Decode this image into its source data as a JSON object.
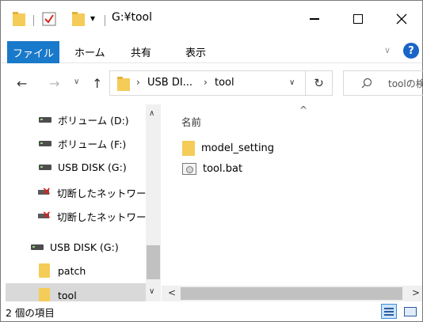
{
  "titlebar": {
    "title": "G:¥tool",
    "dropdown_glyph": "▾"
  },
  "ribbon": {
    "tabs": [
      "ファイル",
      "ホーム",
      "共有",
      "表示"
    ],
    "help_label": "?"
  },
  "navbar": {
    "path_segments": [
      "USB DI...",
      "tool"
    ],
    "search_placeholder": "toolの検索"
  },
  "nav_pane": {
    "items": [
      {
        "label": "ボリューム (D:)",
        "icon": "drive-icon"
      },
      {
        "label": "ボリューム (F:)",
        "icon": "drive-icon"
      },
      {
        "label": "USB DISK (G:)",
        "icon": "drive-icon"
      },
      {
        "label": "切断したネットワーク",
        "icon": "disconnected-network-drive-icon"
      },
      {
        "label": "切断したネットワーク",
        "icon": "disconnected-network-drive-icon"
      },
      {
        "label": "USB DISK (G:)",
        "icon": "drive-icon"
      },
      {
        "label": "patch",
        "icon": "folder-icon"
      },
      {
        "label": "tool",
        "icon": "folder-icon",
        "selected": true
      }
    ]
  },
  "content": {
    "column_header": "名前",
    "files": [
      {
        "name": "model_setting",
        "icon": "folder-icon"
      },
      {
        "name": "tool.bat",
        "icon": "batch-file-icon"
      }
    ]
  },
  "statusbar": {
    "item_count": "2 個の項目"
  },
  "colors": {
    "accent": "#1979ca",
    "folder": "#f5cc57",
    "selection": "#d9d9d9"
  }
}
